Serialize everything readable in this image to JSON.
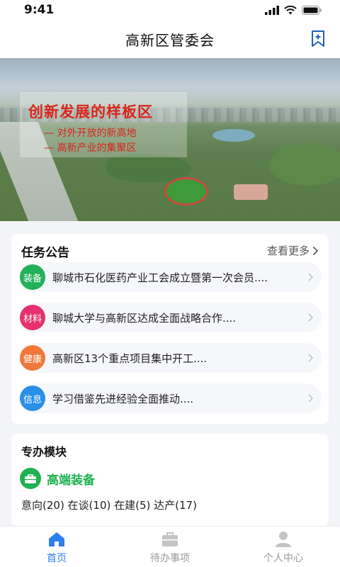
{
  "status_bar": {
    "time": "9:41"
  },
  "header": {
    "title": "高新区管委会"
  },
  "banner": {
    "headline": "创新发展的样板区",
    "line1": "— 对外开放的新高地",
    "line2": "— 高新产业的集聚区"
  },
  "notices": {
    "title": "任务公告",
    "more_label": "查看更多",
    "items": [
      {
        "badge": "装备",
        "badge_color": "#22b15a",
        "text": "聊城市石化医药产业工会成立暨第一次会员...."
      },
      {
        "badge": "材料",
        "badge_color": "#e5326f",
        "text": "聊城大学与高新区达成全面战略合作...."
      },
      {
        "badge": "健康",
        "badge_color": "#f0793a",
        "text": "高新区13个重点项目集中开工...."
      },
      {
        "badge": "信息",
        "badge_color": "#2a8fe6",
        "text": "学习借鉴先进经验全面推动...."
      }
    ]
  },
  "modules": {
    "title": "专办模块",
    "name": "高端装备",
    "icon": "briefcase-icon",
    "stats": "意向(20) 在谈(10)  在建(5) 达产(17)"
  },
  "tabbar": {
    "active_color": "#2e7ef0",
    "tabs": [
      {
        "label": "首页",
        "icon": "home-icon"
      },
      {
        "label": "待办事项",
        "icon": "briefcase-icon"
      },
      {
        "label": "个人中心",
        "icon": "user-icon"
      }
    ]
  }
}
